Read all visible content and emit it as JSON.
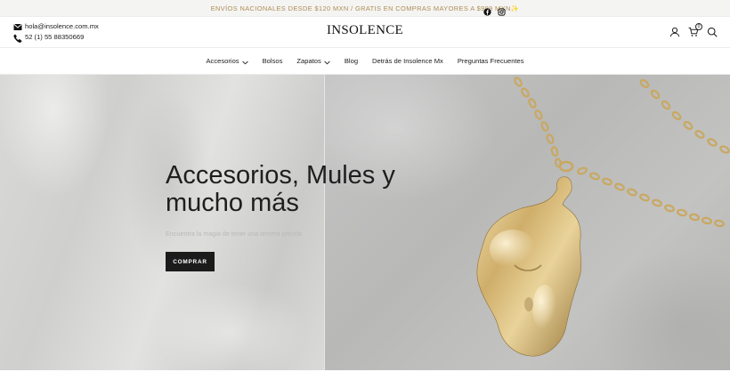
{
  "announcement": {
    "text": "ENVÍOS NACIONALES DESDE $120 MXN / GRATIS EN COMPRAS MAYORES A $999 MXN✨",
    "social_icons": [
      "facebook-icon",
      "instagram-icon"
    ]
  },
  "header": {
    "email": "hola@insolence.com.mx",
    "phone": "52 (1) 55 88350669",
    "logo_text": "INSOLENCE",
    "cart_count": "0",
    "icons": [
      "account-icon",
      "cart-icon",
      "search-icon"
    ]
  },
  "nav": {
    "items": [
      {
        "label": "Accesorios",
        "has_dropdown": true
      },
      {
        "label": "Bolsos",
        "has_dropdown": false
      },
      {
        "label": "Zapatos",
        "has_dropdown": true
      },
      {
        "label": "Blog",
        "has_dropdown": false
      },
      {
        "label": "Detrás de Insolence Mx",
        "has_dropdown": false
      },
      {
        "label": "Preguntas Frecuentes",
        "has_dropdown": false
      }
    ]
  },
  "hero": {
    "title": "Accesorios, Mules y mucho más",
    "subtitle": "Encuentra la magia de tener una tercera prenda",
    "button_label": "COMPRAR"
  },
  "colors": {
    "announcement_text": "#b08d57",
    "button_bg": "#1b1b1b",
    "gold": "#c9a860"
  }
}
